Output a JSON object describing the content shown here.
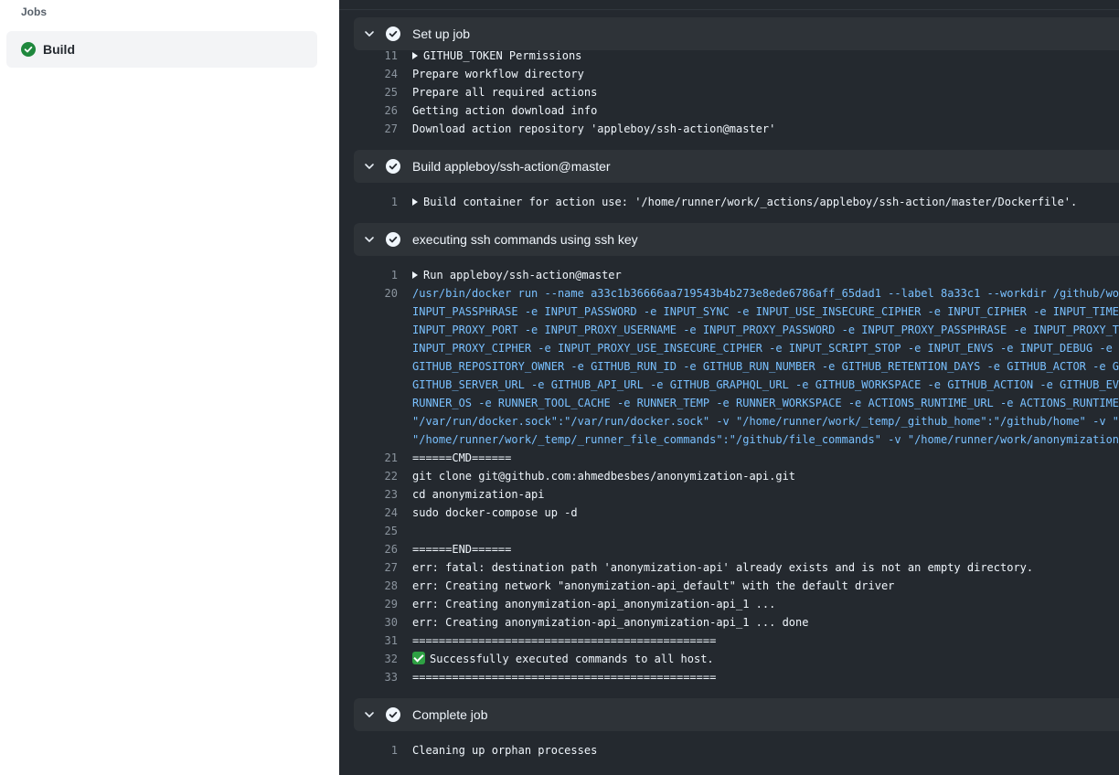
{
  "sidebar": {
    "heading": "Jobs",
    "job": {
      "label": "Build",
      "status": "success"
    }
  },
  "colors": {
    "success": "#2ea043",
    "log_bg": "#24292f",
    "cmd_blue": "#79c0ff"
  },
  "steps": [
    {
      "title": "Set up job",
      "lines": [
        {
          "n": "11",
          "t": "GITHUB_TOKEN Permissions",
          "collapsible": true
        },
        {
          "n": "24",
          "t": "Prepare workflow directory"
        },
        {
          "n": "25",
          "t": "Prepare all required actions"
        },
        {
          "n": "26",
          "t": "Getting action download info"
        },
        {
          "n": "27",
          "t": "Download action repository 'appleboy/ssh-action@master'"
        }
      ]
    },
    {
      "title": "Build appleboy/ssh-action@master",
      "lines": [
        {
          "n": "1",
          "t": "Build container for action use: '/home/runner/work/_actions/appleboy/ssh-action/master/Dockerfile'.",
          "collapsible": true
        }
      ]
    },
    {
      "title": "executing ssh commands using ssh key",
      "lines": [
        {
          "n": "1",
          "t": "Run appleboy/ssh-action@master",
          "collapsible": true
        },
        {
          "n": "20",
          "t": "/usr/bin/docker run --name a33c1b36666aa719543b4b273e8ede6786aff_65dad1 --label 8a33c1 --workdir /github/wo",
          "style": "cmd"
        },
        {
          "n": "",
          "t": "INPUT_PASSPHRASE -e INPUT_PASSWORD -e INPUT_SYNC -e INPUT_USE_INSECURE_CIPHER -e INPUT_CIPHER -e INPUT_TIME",
          "style": "cmd"
        },
        {
          "n": "",
          "t": "INPUT_PROXY_PORT -e INPUT_PROXY_USERNAME -e INPUT_PROXY_PASSWORD -e INPUT_PROXY_PASSPHRASE -e INPUT_PROXY_T",
          "style": "cmd"
        },
        {
          "n": "",
          "t": "INPUT_PROXY_CIPHER -e INPUT_PROXY_USE_INSECURE_CIPHER -e INPUT_SCRIPT_STOP -e INPUT_ENVS -e INPUT_DEBUG -e",
          "style": "cmd"
        },
        {
          "n": "",
          "t": "GITHUB_REPOSITORY_OWNER -e GITHUB_RUN_ID -e GITHUB_RUN_NUMBER -e GITHUB_RETENTION_DAYS -e GITHUB_ACTOR -e G",
          "style": "cmd"
        },
        {
          "n": "",
          "t": "GITHUB_SERVER_URL -e GITHUB_API_URL -e GITHUB_GRAPHQL_URL -e GITHUB_WORKSPACE -e GITHUB_ACTION -e GITHUB_EV",
          "style": "cmd"
        },
        {
          "n": "",
          "t": "RUNNER_OS -e RUNNER_TOOL_CACHE -e RUNNER_TEMP -e RUNNER_WORKSPACE -e ACTIONS_RUNTIME_URL -e ACTIONS_RUNTIME",
          "style": "cmd"
        },
        {
          "n": "",
          "t": "\"/var/run/docker.sock\":\"/var/run/docker.sock\" -v \"/home/runner/work/_temp/_github_home\":\"/github/home\" -v \"",
          "style": "cmd"
        },
        {
          "n": "",
          "t": "\"/home/runner/work/_temp/_runner_file_commands\":\"/github/file_commands\" -v \"/home/runner/work/anonymization",
          "style": "cmd"
        },
        {
          "n": "21",
          "t": "======CMD======"
        },
        {
          "n": "22",
          "t": "git clone git@github.com:ahmedbesbes/anonymization-api.git"
        },
        {
          "n": "23",
          "t": "cd anonymization-api"
        },
        {
          "n": "24",
          "t": "sudo docker-compose up -d"
        },
        {
          "n": "25",
          "t": ""
        },
        {
          "n": "26",
          "t": "======END======"
        },
        {
          "n": "27",
          "t": "err: fatal: destination path 'anonymization-api' already exists and is not an empty directory."
        },
        {
          "n": "28",
          "t": "err: Creating network \"anonymization-api_default\" with the default driver"
        },
        {
          "n": "29",
          "t": "err: Creating anonymization-api_anonymization-api_1 ..."
        },
        {
          "n": "30",
          "t": "err: Creating anonymization-api_anonymization-api_1 ... done"
        },
        {
          "n": "31",
          "t": "=============================================="
        },
        {
          "n": "32",
          "t": "Successfully executed commands to all host.",
          "emoji": "check-emoji"
        },
        {
          "n": "33",
          "t": "=============================================="
        }
      ]
    },
    {
      "title": "Complete job",
      "lines": [
        {
          "n": "1",
          "t": "Cleaning up orphan processes"
        }
      ]
    }
  ]
}
